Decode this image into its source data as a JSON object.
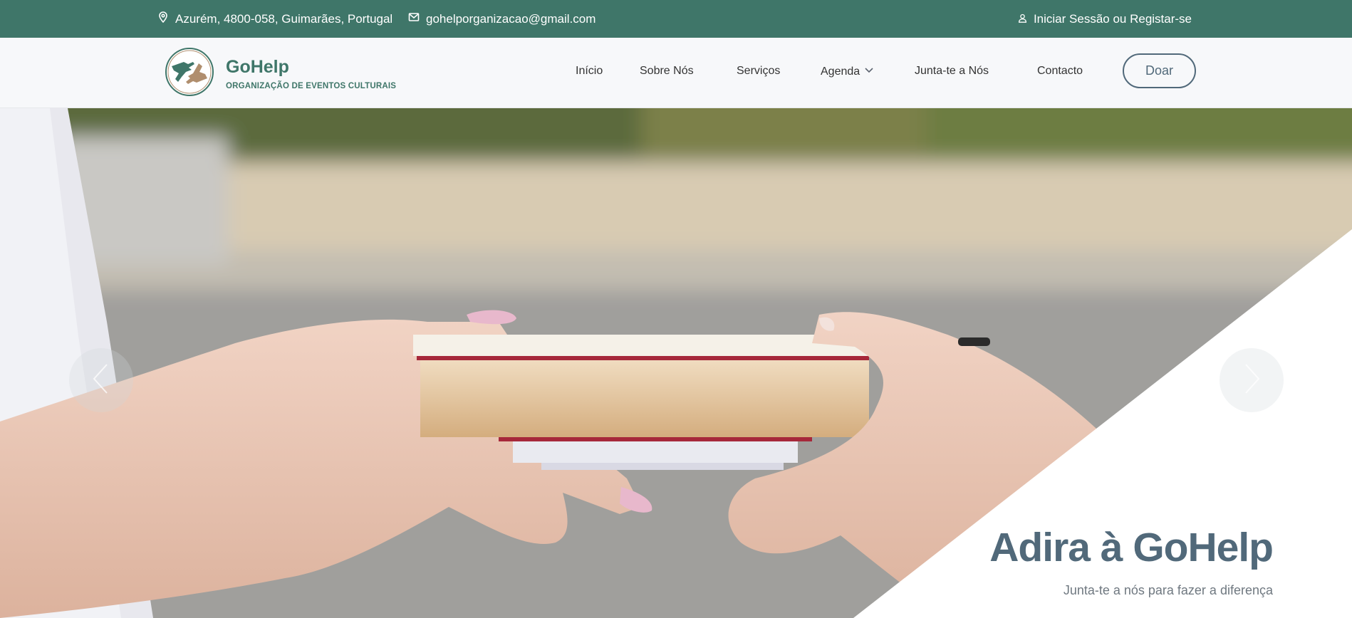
{
  "topbar": {
    "address": "Azurém, 4800-058, Guimarães, Portugal",
    "email": "gohelporganizacao@gmail.com",
    "login": "Iniciar Sessão ou Registar-se",
    "icons": [
      "map-pin-icon",
      "envelope-icon",
      "user-icon"
    ]
  },
  "brand": {
    "name": "GoHelp",
    "tagline": "ORGANIZAÇÃO DE EVENTOS CULTURAIS"
  },
  "nav": {
    "items": [
      {
        "label": "Início"
      },
      {
        "label": "Sobre Nós"
      },
      {
        "label": "Serviços"
      },
      {
        "label": "Agenda",
        "has_dropdown": true
      },
      {
        "label": "Junta-te a Nós"
      },
      {
        "label": "Contacto"
      }
    ],
    "donate_label": "Doar"
  },
  "hero": {
    "title": "Adira à GoHelp",
    "subtitle": "Junta-te a nós para fazer a diferença",
    "prev_icon": "chevron-left-icon",
    "next_icon": "chevron-right-icon"
  },
  "colors": {
    "brand_green": "#3f7669",
    "brand_slate": "#51697a",
    "header_bg": "#f7f8fa",
    "logo_tan": "#b08e6e"
  }
}
